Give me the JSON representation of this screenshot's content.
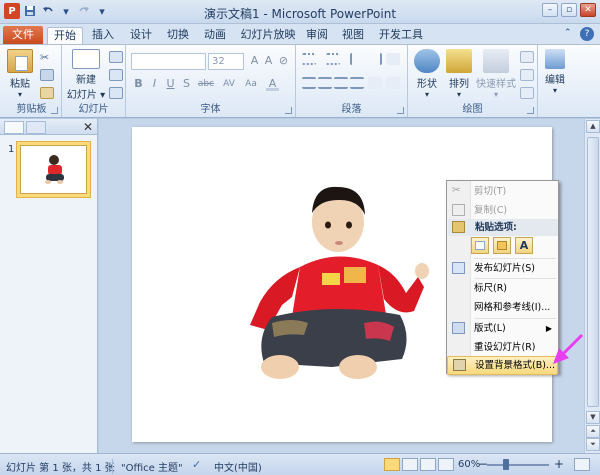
{
  "title_bar": {
    "title": "演示文稿1 - Microsoft PowerPoint",
    "app_logo": "P",
    "qat_icons": [
      "save-icon",
      "undo-icon",
      "redo-icon",
      "customize-icon"
    ]
  },
  "tabs": {
    "file": "文件",
    "items": [
      "开始",
      "插入",
      "设计",
      "切换",
      "动画",
      "幻灯片放映",
      "审阅",
      "视图",
      "开发工具"
    ],
    "active": "开始"
  },
  "ribbon": {
    "clipboard": {
      "paste": "粘贴",
      "label": "剪贴板"
    },
    "slides": {
      "new_slide": "新建\n幻灯片",
      "new_slide_l1": "新建",
      "new_slide_l2": "幻灯片 ▾",
      "label": "幻灯片"
    },
    "font": {
      "font_name": "",
      "font_size": "32",
      "label": "字体",
      "buttons": [
        "B",
        "I",
        "U",
        "S",
        "abc",
        "AV",
        "Aa",
        "A"
      ]
    },
    "paragraph": {
      "label": "段落"
    },
    "drawing": {
      "shapes": "形状",
      "arrange": "排列",
      "quick_styles": "快速样式",
      "label": "绘图"
    },
    "editing": {
      "label": "编辑"
    }
  },
  "slide_panel": {
    "slide_number": "1"
  },
  "context_menu": {
    "items": [
      {
        "label": "剪切(T)",
        "enabled": false,
        "icon": "scissors-icon"
      },
      {
        "label": "复制(C)",
        "enabled": false,
        "icon": "copy-icon"
      },
      {
        "label": "粘贴选项:",
        "header": true,
        "icon": "paste-icon"
      },
      {
        "label": "发布幻灯片(S)",
        "enabled": true,
        "icon": "publish-icon"
      },
      {
        "label": "标尺(R)",
        "enabled": true
      },
      {
        "label": "网格和参考线(I)...",
        "enabled": true
      },
      {
        "label": "版式(L)",
        "enabled": true,
        "submenu": true,
        "icon": "layout-icon"
      },
      {
        "label": "重设幻灯片(R)",
        "enabled": true
      },
      {
        "label": "设置背景格式(B)...",
        "enabled": true,
        "highlighted": true,
        "icon": "format-background-icon"
      }
    ],
    "paste_option_labels": [
      "",
      "",
      "A"
    ]
  },
  "status_bar": {
    "slide_info": "幻灯片 第 1 张，共 1 张",
    "theme": "\"Office 主题\"",
    "language": "中文(中国)",
    "zoom": "60%"
  },
  "colors": {
    "file_tab": "#c84a1d",
    "accent_blue": "#1e395b",
    "highlight": "#f8d97c",
    "arrow": "#e83ef0"
  }
}
